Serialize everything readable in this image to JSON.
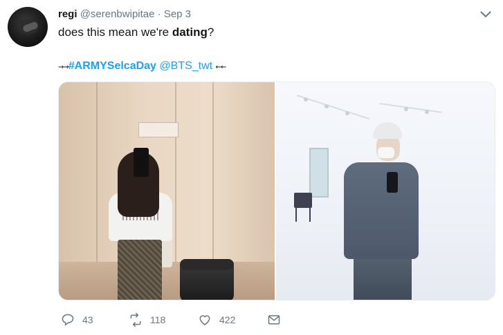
{
  "tweet": {
    "display_name": "regi",
    "handle": "@serenbwipitae",
    "separator": "·",
    "date": "Sep 3",
    "text_before": "does this mean we're ",
    "text_bold": "dating",
    "text_after": "?",
    "tag_line": {
      "left_deco": "⇝⇝",
      "hashtag": "#ARMYSelcaDay",
      "mention": "@BTS_twt",
      "right_deco": "⇜⇜"
    }
  },
  "icons": {
    "caret": "chevron-down-icon",
    "reply": "reply-icon",
    "retweet": "retweet-icon",
    "like": "heart-icon",
    "dm": "envelope-icon"
  },
  "actions": {
    "reply_count": "43",
    "retweet_count": "118",
    "like_count": "422"
  },
  "colors": {
    "link": "#1da1f2",
    "muted": "#657786",
    "text": "#14171a"
  }
}
